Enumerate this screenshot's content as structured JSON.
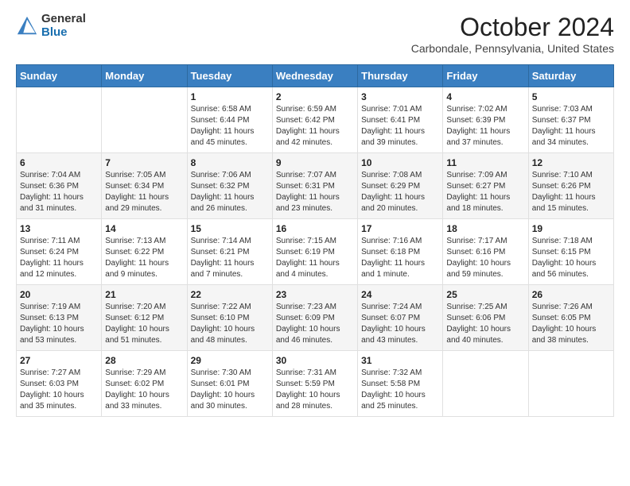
{
  "header": {
    "logo_general": "General",
    "logo_blue": "Blue",
    "month_title": "October 2024",
    "location": "Carbondale, Pennsylvania, United States"
  },
  "days_of_week": [
    "Sunday",
    "Monday",
    "Tuesday",
    "Wednesday",
    "Thursday",
    "Friday",
    "Saturday"
  ],
  "weeks": [
    [
      {
        "day": "",
        "sunrise": "",
        "sunset": "",
        "daylight": ""
      },
      {
        "day": "",
        "sunrise": "",
        "sunset": "",
        "daylight": ""
      },
      {
        "day": "1",
        "sunrise": "Sunrise: 6:58 AM",
        "sunset": "Sunset: 6:44 PM",
        "daylight": "Daylight: 11 hours and 45 minutes."
      },
      {
        "day": "2",
        "sunrise": "Sunrise: 6:59 AM",
        "sunset": "Sunset: 6:42 PM",
        "daylight": "Daylight: 11 hours and 42 minutes."
      },
      {
        "day": "3",
        "sunrise": "Sunrise: 7:01 AM",
        "sunset": "Sunset: 6:41 PM",
        "daylight": "Daylight: 11 hours and 39 minutes."
      },
      {
        "day": "4",
        "sunrise": "Sunrise: 7:02 AM",
        "sunset": "Sunset: 6:39 PM",
        "daylight": "Daylight: 11 hours and 37 minutes."
      },
      {
        "day": "5",
        "sunrise": "Sunrise: 7:03 AM",
        "sunset": "Sunset: 6:37 PM",
        "daylight": "Daylight: 11 hours and 34 minutes."
      }
    ],
    [
      {
        "day": "6",
        "sunrise": "Sunrise: 7:04 AM",
        "sunset": "Sunset: 6:36 PM",
        "daylight": "Daylight: 11 hours and 31 minutes."
      },
      {
        "day": "7",
        "sunrise": "Sunrise: 7:05 AM",
        "sunset": "Sunset: 6:34 PM",
        "daylight": "Daylight: 11 hours and 29 minutes."
      },
      {
        "day": "8",
        "sunrise": "Sunrise: 7:06 AM",
        "sunset": "Sunset: 6:32 PM",
        "daylight": "Daylight: 11 hours and 26 minutes."
      },
      {
        "day": "9",
        "sunrise": "Sunrise: 7:07 AM",
        "sunset": "Sunset: 6:31 PM",
        "daylight": "Daylight: 11 hours and 23 minutes."
      },
      {
        "day": "10",
        "sunrise": "Sunrise: 7:08 AM",
        "sunset": "Sunset: 6:29 PM",
        "daylight": "Daylight: 11 hours and 20 minutes."
      },
      {
        "day": "11",
        "sunrise": "Sunrise: 7:09 AM",
        "sunset": "Sunset: 6:27 PM",
        "daylight": "Daylight: 11 hours and 18 minutes."
      },
      {
        "day": "12",
        "sunrise": "Sunrise: 7:10 AM",
        "sunset": "Sunset: 6:26 PM",
        "daylight": "Daylight: 11 hours and 15 minutes."
      }
    ],
    [
      {
        "day": "13",
        "sunrise": "Sunrise: 7:11 AM",
        "sunset": "Sunset: 6:24 PM",
        "daylight": "Daylight: 11 hours and 12 minutes."
      },
      {
        "day": "14",
        "sunrise": "Sunrise: 7:13 AM",
        "sunset": "Sunset: 6:22 PM",
        "daylight": "Daylight: 11 hours and 9 minutes."
      },
      {
        "day": "15",
        "sunrise": "Sunrise: 7:14 AM",
        "sunset": "Sunset: 6:21 PM",
        "daylight": "Daylight: 11 hours and 7 minutes."
      },
      {
        "day": "16",
        "sunrise": "Sunrise: 7:15 AM",
        "sunset": "Sunset: 6:19 PM",
        "daylight": "Daylight: 11 hours and 4 minutes."
      },
      {
        "day": "17",
        "sunrise": "Sunrise: 7:16 AM",
        "sunset": "Sunset: 6:18 PM",
        "daylight": "Daylight: 11 hours and 1 minute."
      },
      {
        "day": "18",
        "sunrise": "Sunrise: 7:17 AM",
        "sunset": "Sunset: 6:16 PM",
        "daylight": "Daylight: 10 hours and 59 minutes."
      },
      {
        "day": "19",
        "sunrise": "Sunrise: 7:18 AM",
        "sunset": "Sunset: 6:15 PM",
        "daylight": "Daylight: 10 hours and 56 minutes."
      }
    ],
    [
      {
        "day": "20",
        "sunrise": "Sunrise: 7:19 AM",
        "sunset": "Sunset: 6:13 PM",
        "daylight": "Daylight: 10 hours and 53 minutes."
      },
      {
        "day": "21",
        "sunrise": "Sunrise: 7:20 AM",
        "sunset": "Sunset: 6:12 PM",
        "daylight": "Daylight: 10 hours and 51 minutes."
      },
      {
        "day": "22",
        "sunrise": "Sunrise: 7:22 AM",
        "sunset": "Sunset: 6:10 PM",
        "daylight": "Daylight: 10 hours and 48 minutes."
      },
      {
        "day": "23",
        "sunrise": "Sunrise: 7:23 AM",
        "sunset": "Sunset: 6:09 PM",
        "daylight": "Daylight: 10 hours and 46 minutes."
      },
      {
        "day": "24",
        "sunrise": "Sunrise: 7:24 AM",
        "sunset": "Sunset: 6:07 PM",
        "daylight": "Daylight: 10 hours and 43 minutes."
      },
      {
        "day": "25",
        "sunrise": "Sunrise: 7:25 AM",
        "sunset": "Sunset: 6:06 PM",
        "daylight": "Daylight: 10 hours and 40 minutes."
      },
      {
        "day": "26",
        "sunrise": "Sunrise: 7:26 AM",
        "sunset": "Sunset: 6:05 PM",
        "daylight": "Daylight: 10 hours and 38 minutes."
      }
    ],
    [
      {
        "day": "27",
        "sunrise": "Sunrise: 7:27 AM",
        "sunset": "Sunset: 6:03 PM",
        "daylight": "Daylight: 10 hours and 35 minutes."
      },
      {
        "day": "28",
        "sunrise": "Sunrise: 7:29 AM",
        "sunset": "Sunset: 6:02 PM",
        "daylight": "Daylight: 10 hours and 33 minutes."
      },
      {
        "day": "29",
        "sunrise": "Sunrise: 7:30 AM",
        "sunset": "Sunset: 6:01 PM",
        "daylight": "Daylight: 10 hours and 30 minutes."
      },
      {
        "day": "30",
        "sunrise": "Sunrise: 7:31 AM",
        "sunset": "Sunset: 5:59 PM",
        "daylight": "Daylight: 10 hours and 28 minutes."
      },
      {
        "day": "31",
        "sunrise": "Sunrise: 7:32 AM",
        "sunset": "Sunset: 5:58 PM",
        "daylight": "Daylight: 10 hours and 25 minutes."
      },
      {
        "day": "",
        "sunrise": "",
        "sunset": "",
        "daylight": ""
      },
      {
        "day": "",
        "sunrise": "",
        "sunset": "",
        "daylight": ""
      }
    ]
  ]
}
